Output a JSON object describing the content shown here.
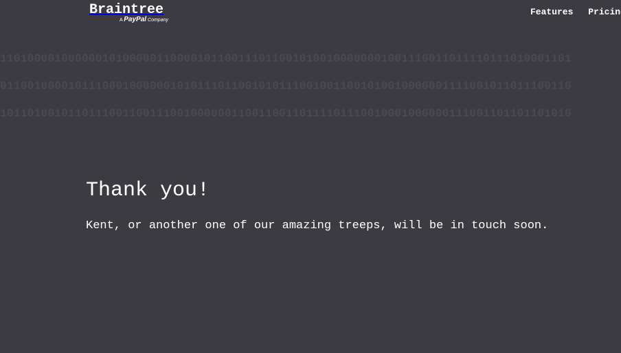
{
  "header": {
    "logo_text": "Braintree",
    "logo_tagline_prefix": "A",
    "logo_tagline_brand": "PayPal",
    "logo_tagline_suffix": "Company",
    "nav": [
      {
        "label": "Features"
      },
      {
        "label": "Pricing"
      }
    ]
  },
  "background_binary": [
    "110100001000000101000001100001011001110110010100100000001001110011011110111010001101",
    "011001000010111000100000010101110110010101110010011001010010000001111001011011100110",
    "101101001011011100110011100100000011001100110111101110010001000000111001101101101010"
  ],
  "main": {
    "title": "Thank you!",
    "message": "Kent, or another one of our amazing treeps, will be in touch soon."
  },
  "colors": {
    "background": "#3d3b42",
    "text": "#ffffff",
    "binary_text": "#4b4950"
  }
}
